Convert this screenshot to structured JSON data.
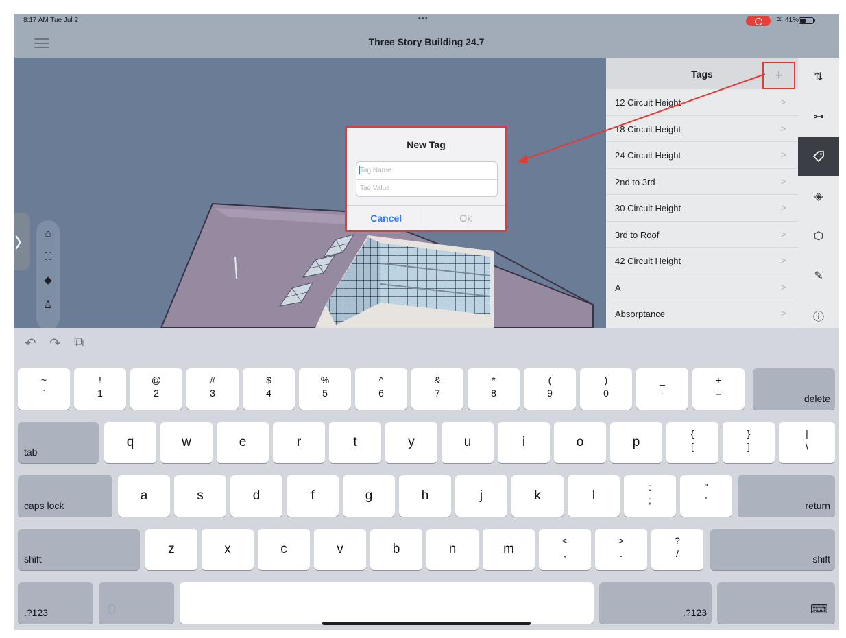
{
  "status_bar": {
    "time": "8:17 AM  Tue Jul 2",
    "dots": "•••",
    "battery": "41%"
  },
  "app": {
    "title": "Three Story Building 24.7"
  },
  "tags_panel": {
    "title": "Tags",
    "add_label": "+",
    "chevron": ">",
    "items": [
      {
        "label": "12 Circuit Height"
      },
      {
        "label": "18 Circuit Height"
      },
      {
        "label": "24 Circuit Height"
      },
      {
        "label": "2nd to 3rd"
      },
      {
        "label": "30 Circuit Height"
      },
      {
        "label": "3rd to Roof"
      },
      {
        "label": "42 Circuit Height"
      },
      {
        "label": "A"
      },
      {
        "label": "Absorptance"
      }
    ]
  },
  "dialog": {
    "title": "New Tag",
    "name_placeholder": "Tag Name",
    "value_placeholder": "Tag Value",
    "cancel": "Cancel",
    "ok": "Ok"
  },
  "keyboard": {
    "row1": [
      {
        "top": "~",
        "bottom": "`"
      },
      {
        "top": "!",
        "bottom": "1"
      },
      {
        "top": "@",
        "bottom": "2"
      },
      {
        "top": "#",
        "bottom": "3"
      },
      {
        "top": "$",
        "bottom": "4"
      },
      {
        "top": "%",
        "bottom": "5"
      },
      {
        "top": "^",
        "bottom": "6"
      },
      {
        "top": "&",
        "bottom": "7"
      },
      {
        "top": "*",
        "bottom": "8"
      },
      {
        "top": "(",
        "bottom": "9"
      },
      {
        "top": ")",
        "bottom": "0"
      },
      {
        "top": "_",
        "bottom": "-"
      },
      {
        "top": "+",
        "bottom": "="
      }
    ],
    "delete": "delete",
    "tab": "tab",
    "row2": [
      "q",
      "w",
      "e",
      "r",
      "t",
      "y",
      "u",
      "i",
      "o",
      "p"
    ],
    "row2_sym": [
      {
        "top": "{",
        "bottom": "["
      },
      {
        "top": "}",
        "bottom": "]"
      },
      {
        "top": "|",
        "bottom": "\\"
      }
    ],
    "caps": "caps lock",
    "row3": [
      "a",
      "s",
      "d",
      "f",
      "g",
      "h",
      "j",
      "k",
      "l"
    ],
    "row3_sym": [
      {
        "top": ":",
        "bottom": ";"
      },
      {
        "top": "\"",
        "bottom": "'"
      }
    ],
    "return": "return",
    "shift": "shift",
    "row4": [
      "z",
      "x",
      "c",
      "v",
      "b",
      "n",
      "m"
    ],
    "row4_sym": [
      {
        "top": "<",
        "bottom": ","
      },
      {
        "top": ">",
        "bottom": "."
      },
      {
        "top": "?",
        "bottom": "/"
      }
    ],
    "numbers": ".?123"
  },
  "icons": {
    "undo": "↶",
    "redo": "↷",
    "clipboard": "⧉",
    "home": "⌂",
    "fit": "⛶",
    "cube": "◆",
    "person": "♙",
    "expand": "〉",
    "sliders": "⇅",
    "tree": "⊶",
    "tag": "⌂",
    "layers": "◈",
    "box": "⬡",
    "pen": "✎",
    "info": "ⓘ",
    "keyboard_hide": "⌨"
  },
  "colors": {
    "accent": "#2f7cf6",
    "annotation": "#e53935"
  }
}
